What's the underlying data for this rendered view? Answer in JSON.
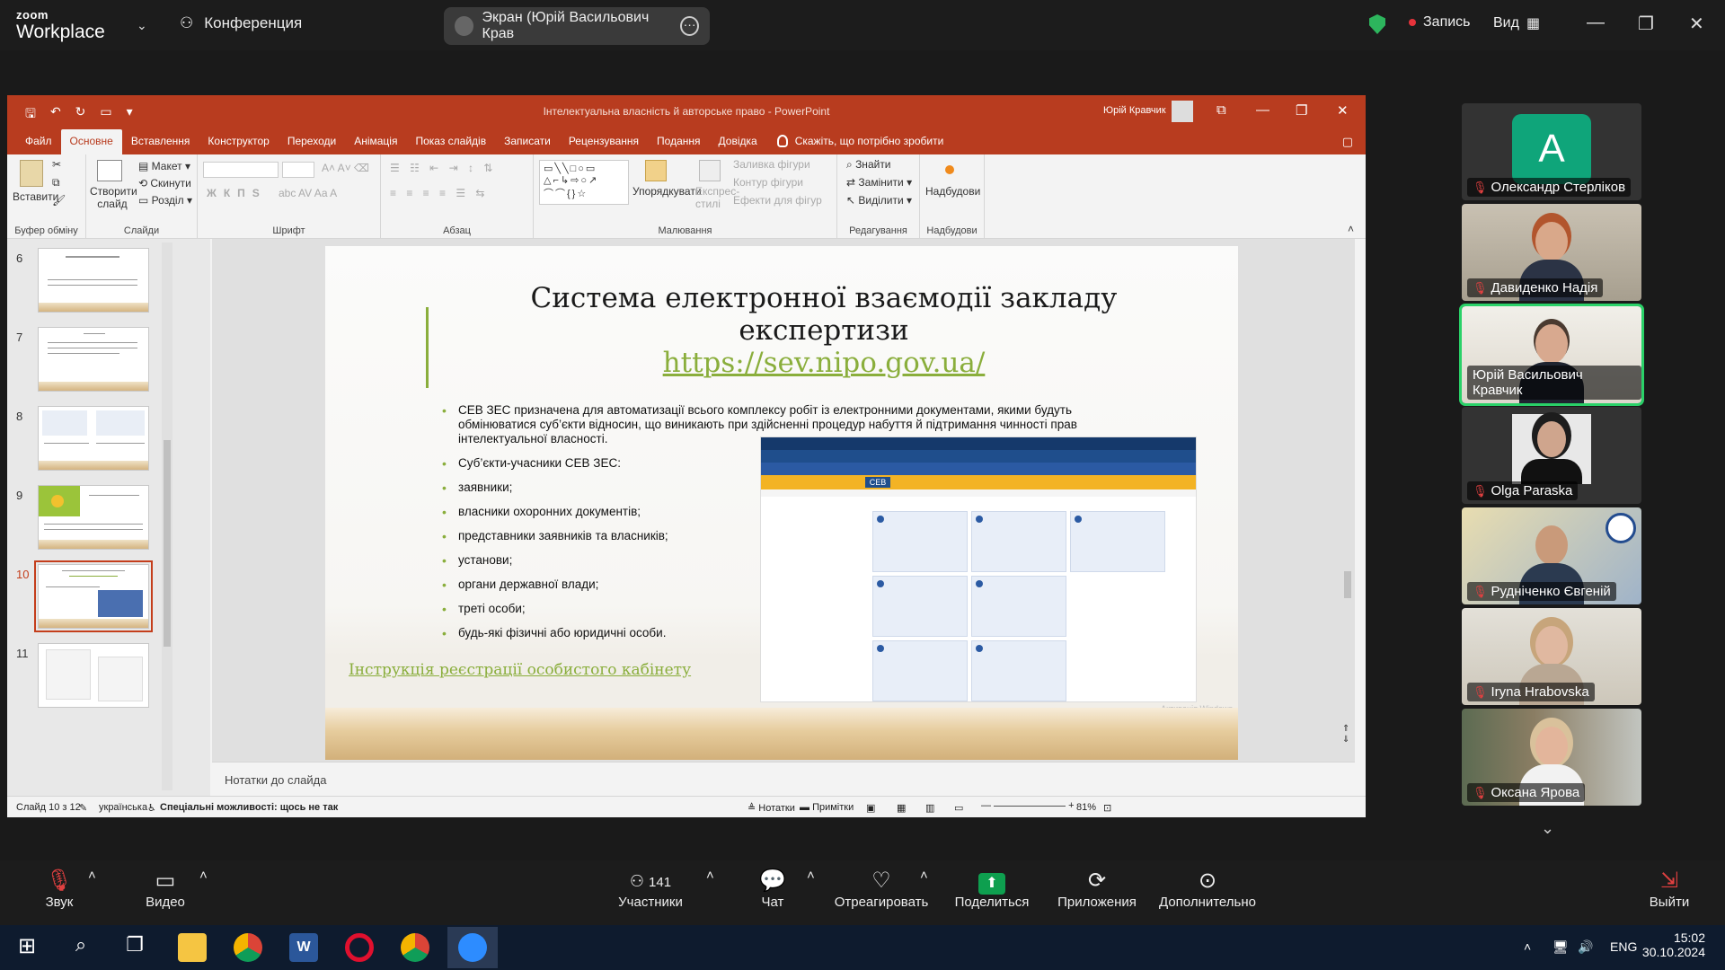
{
  "zoom": {
    "logo_top": "zoom",
    "logo_bottom": "Workplace",
    "conference_label": "Конференция",
    "share_label": "Экран (Юрій Васильович Крав",
    "record_label": "Запись",
    "view_label": "Вид"
  },
  "ppt": {
    "window_title": "Інтелектуальна власність й авторське право  -  PowerPoint",
    "user_name": "Юрій Кравчик",
    "tabs": [
      "Файл",
      "Основне",
      "Вставлення",
      "Конструктор",
      "Переходи",
      "Анімація",
      "Показ слайдів",
      "Записати",
      "Рецензування",
      "Подання",
      "Довідка"
    ],
    "tell_me": "Скажіть, що потрібно зробити",
    "ribbon": {
      "paste": "Вставити",
      "clipboard_group": "Буфер обміну",
      "new_slide": "Створити слайд",
      "layout": "Макет",
      "reset": "Скинути",
      "section": "Розділ",
      "slides_group": "Слайди",
      "font_group": "Шрифт",
      "paragraph_group": "Абзац",
      "arrange": "Упорядкувати",
      "quick_styles": "Експрес-стилі",
      "shape_fill": "Заливка фігури",
      "shape_outline": "Контур фігури",
      "shape_effects": "Ефекти для фігур",
      "drawing_group": "Малювання",
      "find": "Знайти",
      "replace": "Замінити",
      "select": "Виділити",
      "editing_group": "Редагування",
      "addins": "Надбудови",
      "addins_group": "Надбудови"
    },
    "thumb_numbers": [
      "6",
      "7",
      "8",
      "9",
      "10",
      "11"
    ],
    "slide": {
      "title": "Система електронної взаємодії закладу експертизи",
      "url": "https://sev.nipo.gov.ua/",
      "bullets": [
        "СЕВ ЗЕС призначена для автоматизації всього комплексу робіт із електронними документами, якими будуть обмінюватися суб’єкти відносин, що виникають при здійсненні процедур набуття й підтримання чинності прав інтелектуальної власності.",
        "Суб’єкти-учасники СЕВ ЗЕС:",
        "заявники;",
        "власники охоронних документів;",
        "представники заявників та власників;",
        "установи;",
        "органи державної влади;",
        "треті особи;",
        "будь-які фізичні або юридичні особи."
      ],
      "instruction_link": "Інструкція реєстрації особистого кабінету",
      "embed_logo": "СЕВ",
      "watermark": "Активація Windows"
    },
    "notes_placeholder": "Нотатки до слайда",
    "status": {
      "slide_counter": "Слайд 10 з 12",
      "language": "українська",
      "accessibility": "Спеціальні можливості: щось не так",
      "notes_btn": "Нотатки",
      "comments_btn": "Примітки",
      "zoom": "81%"
    }
  },
  "participants": [
    {
      "name": "Олександр Стерліков",
      "avatar": "A"
    },
    {
      "name": "Давиденко Надія"
    },
    {
      "name": "Юрій Васильович Кравчик",
      "active": true
    },
    {
      "name": "Olga Paraska"
    },
    {
      "name": "Рудніченко Євгеній"
    },
    {
      "name": "Iryna  Hrabovska"
    },
    {
      "name": "Оксана Ярова"
    }
  ],
  "toolbar": {
    "audio": "Звук",
    "video": "Видео",
    "participants": "Участники",
    "participants_count": "141",
    "chat": "Чат",
    "react": "Отреагировать",
    "share": "Поделиться",
    "apps": "Приложения",
    "more": "Дополнительно",
    "leave": "Выйти"
  },
  "taskbar": {
    "lang": "ENG",
    "time": "15:02",
    "date": "30.10.2024"
  },
  "colors": {
    "ppt_accent": "#b83c1f",
    "slide_green": "#8aae3c",
    "active_tile": "#2ad168",
    "share_green": "#0e9f4f"
  }
}
